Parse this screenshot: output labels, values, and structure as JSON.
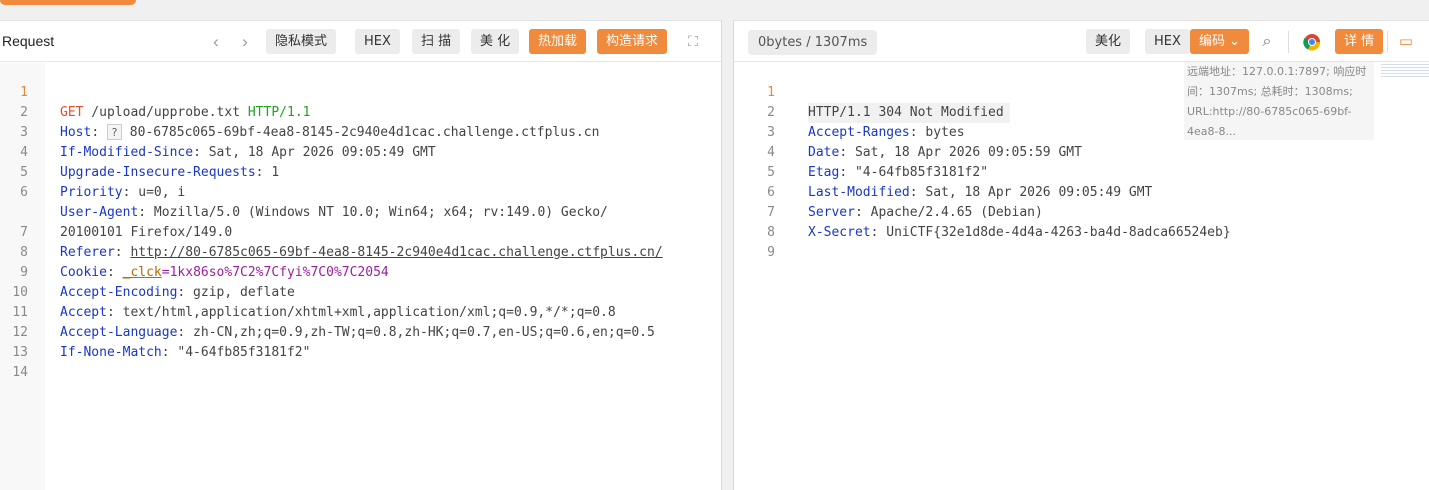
{
  "request": {
    "title": "Request",
    "buttons": {
      "privacy": "隐私模式",
      "hex": "HEX",
      "scan": "扫 描",
      "beautify": "美 化",
      "hotload": "热加载",
      "build": "构造请求"
    },
    "lines": [
      {
        "n": "1",
        "method": "GET",
        "path": " /upload/upprobe.txt ",
        "proto": "HTTP/1.1"
      },
      {
        "n": "2",
        "key": "Host",
        "q": "?",
        "value": " 80-6785c065-69bf-4ea8-8145-2c940e4d1cac.challenge.ctfplus.cn"
      },
      {
        "n": "3",
        "key": "If-Modified-Since",
        "value": ": Sat, 18 Apr 2026 09:05:49 GMT"
      },
      {
        "n": "4",
        "key": "Upgrade-Insecure-Requests",
        "value": ": 1"
      },
      {
        "n": "5",
        "key": "Priority",
        "value": ": u=0, i"
      },
      {
        "n": "6",
        "key": "User-Agent",
        "value": ": Mozilla/5.0 (Windows NT 10.0; Win64; x64; rv:149.0) Gecko/"
      },
      {
        "n": "",
        "value": "20100101 Firefox/149.0"
      },
      {
        "n": "7",
        "key": "Referer",
        "sep": ": ",
        "link": "http://80-6785c065-69bf-4ea8-8145-2c940e4d1cac.challenge.ctfplus.cn/"
      },
      {
        "n": "8",
        "key": "Cookie",
        "sep": ": ",
        "cookie_key": "_clck",
        "cookie_eq": "=",
        "cookie_val": "1kx86so%7C2%7Cfyi%7C0%7C2054"
      },
      {
        "n": "9",
        "key": "Accept-Encoding",
        "value": ": gzip, deflate"
      },
      {
        "n": "10",
        "key": "Accept",
        "value": ": text/html,application/xhtml+xml,application/xml;q=0.9,*/*;q=0.8"
      },
      {
        "n": "11",
        "key": "Accept-Language",
        "value": ": zh-CN,zh;q=0.9,zh-TW;q=0.8,zh-HK;q=0.7,en-US;q=0.6,en;q=0.5"
      },
      {
        "n": "12",
        "key": "If-None-Match",
        "value": ": \"4-64fb85f3181f2\""
      },
      {
        "n": "13"
      },
      {
        "n": "14"
      }
    ]
  },
  "response": {
    "size": "0bytes / 1307ms",
    "buttons": {
      "beautify": "美化",
      "hex": "HEX",
      "encode": "编码",
      "details": "详 情"
    },
    "info": "远端地址：127.0.0.1:7897; 响应时间：1307ms; 总耗时：1308ms; URL:http://80-6785c065-69bf-4ea8-8...",
    "lines": [
      {
        "n": "1",
        "value": "HTTP/1.1 304 Not Modified"
      },
      {
        "n": "2",
        "key": "Accept-Ranges",
        "value": ": bytes"
      },
      {
        "n": "3",
        "key": "Date",
        "value": ": Sat, 18 Apr 2026 09:05:59 GMT"
      },
      {
        "n": "4",
        "key": "Etag",
        "value": ": \"4-64fb85f3181f2\""
      },
      {
        "n": "5",
        "key": "Last-Modified",
        "value": ": Sat, 18 Apr 2026 09:05:49 GMT"
      },
      {
        "n": "6",
        "key": "Server",
        "value": ": Apache/2.4.65 (Debian)"
      },
      {
        "n": "7",
        "key": "X-Secret",
        "value": ": UniCTF{32e1d8de-4d4a-4263-ba4d-8adca66524eb}"
      },
      {
        "n": "8"
      },
      {
        "n": "9"
      }
    ]
  },
  "icons": {
    "prev": "‹",
    "next": "›",
    "expand": "⛶",
    "search": "⌕",
    "chevron": "⌄",
    "chat": "▭"
  }
}
